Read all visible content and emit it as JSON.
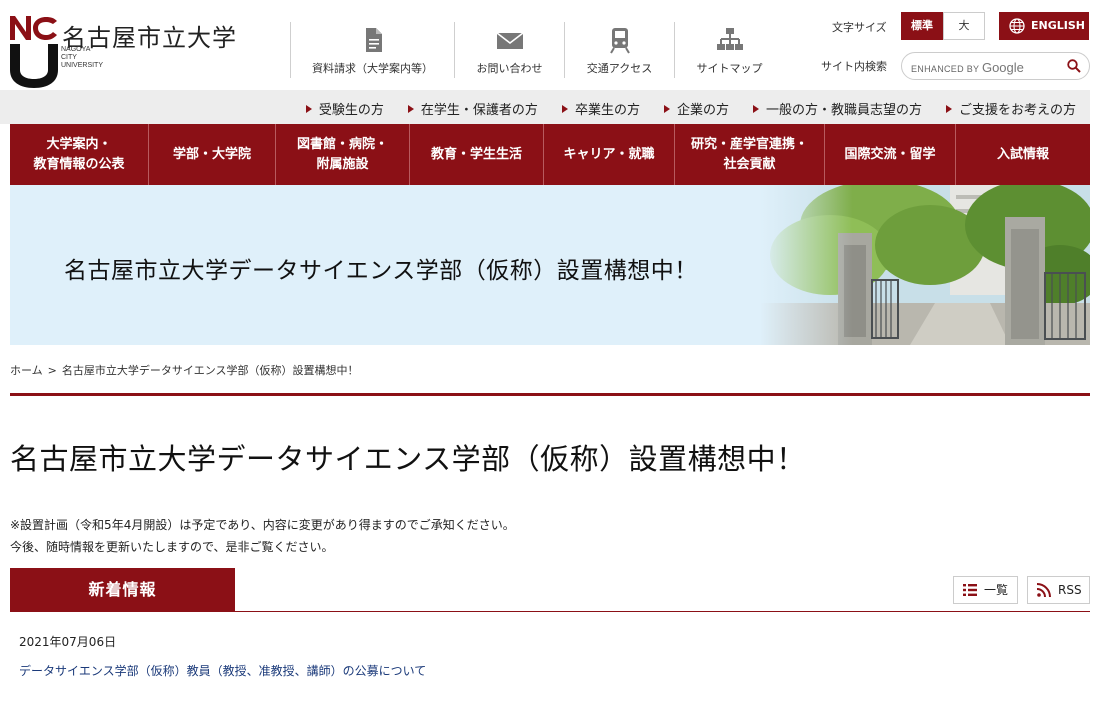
{
  "header": {
    "logo_mark": "NCU",
    "university_name": "名古屋市立大学",
    "university_en": [
      "NAGOYA",
      "CITY",
      "UNIVERSITY"
    ],
    "utility_nav": [
      {
        "label": "資料請求（大学案内等）",
        "icon": "document-icon"
      },
      {
        "label": "お問い合わせ",
        "icon": "mail-icon"
      },
      {
        "label": "交通アクセス",
        "icon": "train-icon"
      },
      {
        "label": "サイトマップ",
        "icon": "sitemap-icon"
      }
    ],
    "font_size_label": "文字サイズ",
    "font_size_standard": "標準",
    "font_size_large": "大",
    "english_label": "ENGLISH",
    "search_label": "サイト内検索",
    "search_enhanced": "ENHANCED BY",
    "search_brand": "Google"
  },
  "audience_nav": [
    "受験生の方",
    "在学生・保護者の方",
    "卒業生の方",
    "企業の方",
    "一般の方・教職員志望の方",
    "ご支援をお考えの方"
  ],
  "main_nav": [
    "大学案内・\n教育情報の公表",
    "学部・大学院",
    "図書館・病院・\n附属施設",
    "教育・学生生活",
    "キャリア・就職",
    "研究・産学官連携・\n社会貢献",
    "国際交流・留学",
    "入試情報"
  ],
  "hero": {
    "title": "名古屋市立大学データサイエンス学部（仮称）設置構想中！"
  },
  "breadcrumb": {
    "home": "ホーム",
    "separator": ">",
    "current": "名古屋市立大学データサイエンス学部（仮称）設置構想中！"
  },
  "page": {
    "title": "名古屋市立大学データサイエンス学部（仮称）設置構想中！",
    "notes": [
      "※設置計画（令和5年4月開設）は予定であり、内容に変更があり得ますのでご承知ください。",
      "今後、随時情報を更新いたしますので、是非ご覧ください。"
    ]
  },
  "news": {
    "heading": "新着情報",
    "list_label": "一覧",
    "rss_label": "RSS",
    "items": [
      {
        "date": "2021年07月06日",
        "title": "データサイエンス学部（仮称）教員（教授、准教授、講師）の公募について"
      }
    ]
  },
  "colors": {
    "accent": "#8b1016",
    "hero_bg": "#dff0fa",
    "link": "#1b3a7a"
  }
}
